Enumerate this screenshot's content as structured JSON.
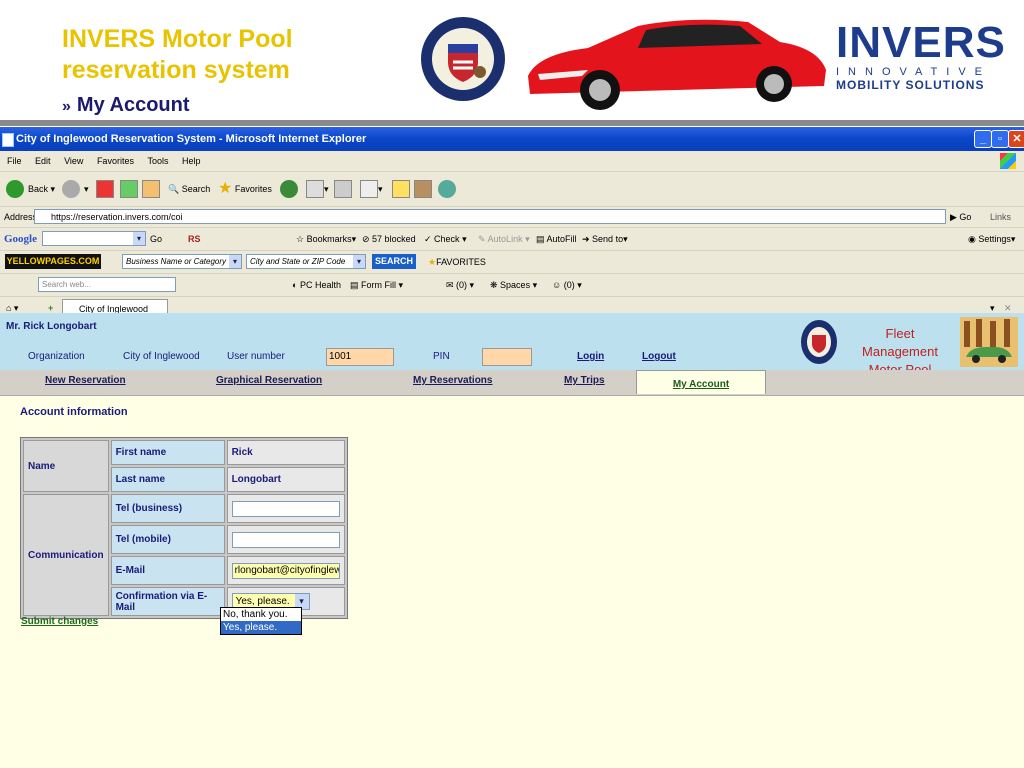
{
  "slide": {
    "title": "INVERS Motor Pool reservation system",
    "subtitle_marker": "»",
    "subtitle": "My Account",
    "logo": {
      "word": "INVERS",
      "tagline1": "INNOVATIVE",
      "tagline2": "MOBILITY SOLUTIONS",
      "color": "#1d3c8c"
    },
    "seal_text": "CITY OF INGLEWOOD · INC. CALIFORNIA 1908"
  },
  "browser": {
    "window_title": "City of Inglewood Reservation System - Microsoft Internet Explorer",
    "menu": [
      "File",
      "Edit",
      "View",
      "Favorites",
      "Tools",
      "Help"
    ],
    "toolbar": {
      "back": "Back",
      "search": "Search",
      "favorites": "Favorites"
    },
    "address_label": "Address",
    "url": "https://reservation.invers.com/coi",
    "go": "Go",
    "links": "Links",
    "google": {
      "logo": "Google",
      "go": "Go",
      "bookmarks": "Bookmarks",
      "blocked": "57 blocked",
      "check": "Check",
      "autolink": "AutoLink",
      "autofill": "AutoFill",
      "sendto": "Send to",
      "settings": "Settings",
      "rs": "RS"
    },
    "yellowpages": {
      "logo": "YELLOWPAGES.COM",
      "business": "Business Name or Category",
      "city": "City and State or ZIP Code",
      "search": "SEARCH",
      "favorites": "FAVORITES"
    },
    "bar4": {
      "search_placeholder": "Search web...",
      "pchealth": "PC Health",
      "formfill": "Form Fill",
      "mail": "(0)",
      "spaces": "Spaces",
      "contacts": "(0)"
    },
    "tab_label": "City of Inglewood Re..."
  },
  "app": {
    "user": "Mr. Rick Longobart",
    "labels": {
      "organization": "Organization",
      "org_value": "City of Inglewood",
      "user_number": "User number",
      "pin": "PIN"
    },
    "user_number_value": "1001",
    "pin_value": "",
    "login": "Login",
    "logout": "Logout",
    "fleet_title": "Fleet Management Motor Pool",
    "nav": [
      "New Reservation",
      "Graphical Reservation",
      "My Reservations",
      "My Trips",
      "My Account"
    ],
    "section_title": "Account information",
    "table": {
      "name_group": "Name",
      "first_name_label": "First name",
      "first_name": "Rick",
      "last_name_label": "Last name",
      "last_name": "Longobart",
      "comm_group": "Communication",
      "tel_business_label": "Tel (business)",
      "tel_business": "",
      "tel_mobile_label": "Tel (mobile)",
      "tel_mobile": "",
      "email_label": "E-Mail",
      "email": "rlongobart@cityofinglewoo",
      "confirm_label": "Confirmation via E-Mail",
      "confirm_value": "Yes, please."
    },
    "dropdown_options": [
      "No, thank you.",
      "Yes, please."
    ],
    "submit": "Submit changes"
  }
}
